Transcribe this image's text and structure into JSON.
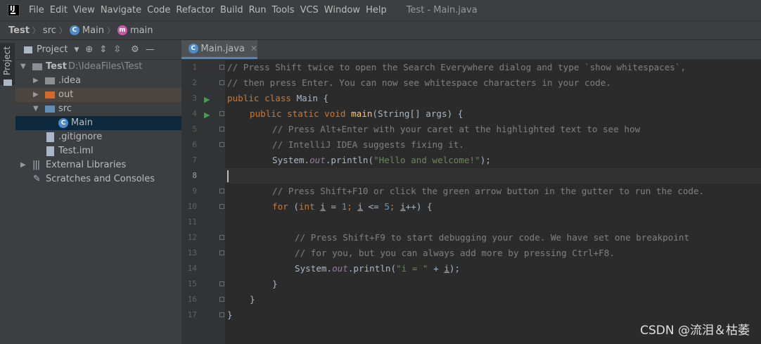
{
  "menubar": {
    "items": [
      "File",
      "Edit",
      "View",
      "Navigate",
      "Code",
      "Refactor",
      "Build",
      "Run",
      "Tools",
      "VCS",
      "Window",
      "Help"
    ],
    "window_title": "Test - Main.java"
  },
  "breadcrumb": {
    "project": "Test",
    "folder": "src",
    "class": "Main",
    "method": "main"
  },
  "sidebar": {
    "tab_label": "Project"
  },
  "project_panel": {
    "view_selector": "Project",
    "tree": [
      {
        "label": "Test",
        "path": "D:\\IdeaFiles\\Test"
      },
      {
        "label": ".idea"
      },
      {
        "label": "out"
      },
      {
        "label": "src"
      },
      {
        "label": "Main"
      },
      {
        "label": ".gitignore"
      },
      {
        "label": "Test.iml"
      },
      {
        "label": "External Libraries"
      },
      {
        "label": "Scratches and Consoles"
      }
    ]
  },
  "editor": {
    "tab_label": "Main.java",
    "line_numbers": [
      "1",
      "2",
      "3",
      "4",
      "5",
      "6",
      "7",
      "8",
      "9",
      "10",
      "11",
      "12",
      "13",
      "14",
      "15",
      "16",
      "17"
    ],
    "lines": {
      "l1": "// Press Shift twice to open the Search Everywhere dialog and type `show whitespaces`,",
      "l2": "// then press Enter. You can now see whitespace characters in your code.",
      "l3_kw": "public class",
      "l3_name": " Main {",
      "l4_kw": "public static void",
      "l4_fn": "main",
      "l4_rest": "(String[] args) {",
      "l6": "// Press Alt+Enter with your caret at the highlighted text to see how",
      "l7": "// IntelliJ IDEA suggests fixing it.",
      "l8_a": "System.",
      "l8_out": "out",
      "l8_b": ".println(",
      "l8_str": "\"Hello and welcome!\"",
      "l8_c": ");",
      "l10": "// Press Shift+F10 or click the green arrow button in the gutter to run the code.",
      "l11_for": "for",
      "l11_int": "int",
      "l11_i": "i",
      "l11_eq": " = ",
      "l11_1": "1",
      "l11_semi": "; ",
      "l11_lt": " <= ",
      "l11_5": "5",
      "l11_inc": "++) {",
      "l13": "// Press Shift+F9 to start debugging your code. We have set one breakpoint",
      "l14": "// for you, but you can always add more by pressing Ctrl+F8.",
      "l15_str": "\"i = \"",
      "l15_plus": " + ",
      "l15_end": ");",
      "close": "}"
    }
  },
  "watermark": "CSDN @流泪＆枯萎"
}
